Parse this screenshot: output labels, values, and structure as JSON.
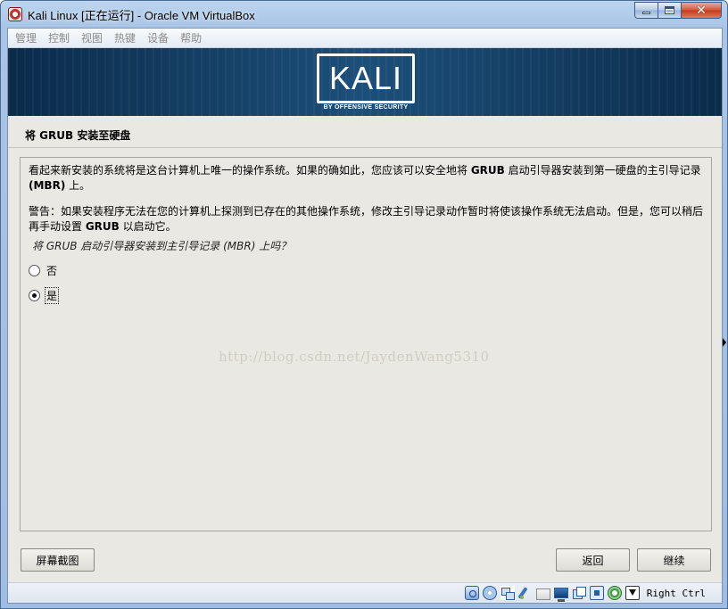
{
  "window": {
    "title": "Kali Linux [正在运行] - Oracle VM VirtualBox",
    "minimize_icon": "minimize-icon",
    "maximize_icon": "maximize-icon",
    "close_icon": "close-icon",
    "close_glyph": "✕"
  },
  "menu": {
    "items": [
      "管理",
      "控制",
      "视图",
      "热键",
      "设备",
      "帮助"
    ]
  },
  "banner": {
    "logo_text": "KALI",
    "logo_subtext": "BY OFFENSIVE SECURITY"
  },
  "installer": {
    "page_title": "将 GRUB 安装至硬盘",
    "para1_a": "看起来新安装的系统将是这台计算机上唯一的操作系统。如果的确如此，您应该可以安全地将 ",
    "para1_b": "GRUB",
    "para1_c": " 启动引导器安装到第一硬盘的主引导记录 ",
    "para1_d": "(MBR)",
    "para1_e": " 上。",
    "para2_a": "警告：如果安装程序无法在您的计算机上探测到已存在的其他操作系统，修改主引导记录动作暂时将使该操作系统无法启动。但是，您可以稍后再手动设置 ",
    "para2_b": "GRUB",
    "para2_c": " 以启动它。",
    "question": "将 GRUB 启动引导器安装到主引导记录 (MBR) 上吗？",
    "options": [
      {
        "label": "否",
        "selected": false
      },
      {
        "label": "是",
        "selected": true
      }
    ],
    "watermark": "http://blog.csdn.net/JaydenWang5310"
  },
  "buttons": {
    "screenshot": "屏幕截图",
    "back": "返回",
    "continue": "继续"
  },
  "statusbar": {
    "icons": [
      "hard-disk-icon",
      "optical-drive-icon",
      "network-icon",
      "usb-icon",
      "shared-folder-icon",
      "display-icon",
      "video-capture-icon",
      "cpu-icon",
      "vt-x-icon",
      "mouse-integration-icon"
    ],
    "host_key": "Right Ctrl"
  }
}
